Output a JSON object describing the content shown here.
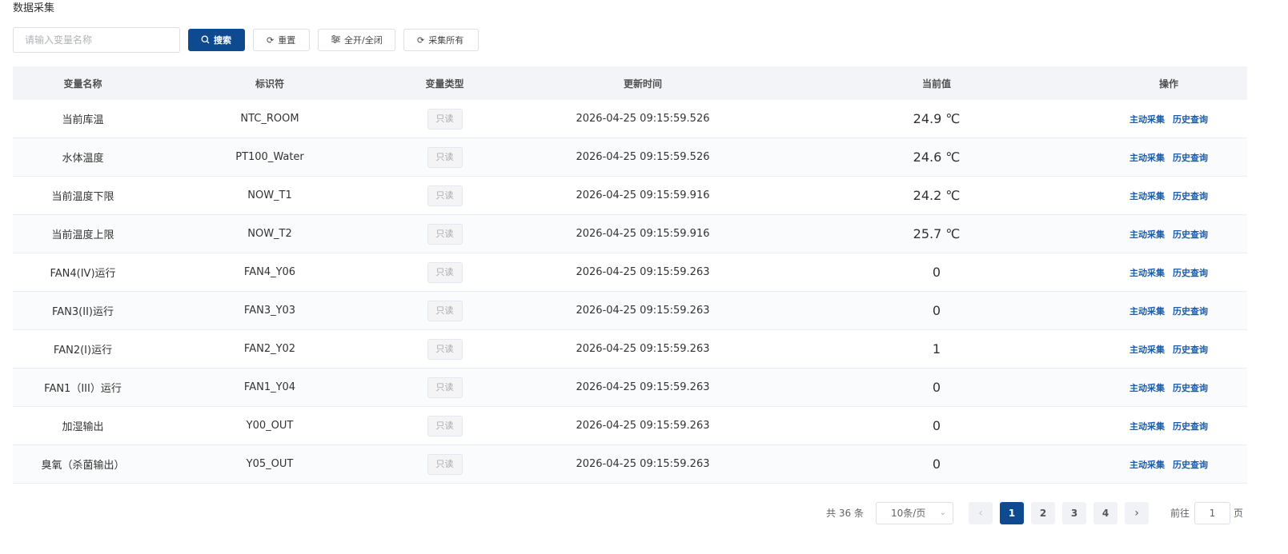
{
  "page": {
    "title": "数据采集"
  },
  "toolbar": {
    "search_placeholder": "请输入变量名称",
    "search_value": "",
    "search_label": "搜索",
    "reset_label": "重置",
    "toggle_label": "全开/全闭",
    "collect_all_label": "采集所有"
  },
  "table": {
    "headers": {
      "name": "变量名称",
      "identifier": "标识符",
      "type": "变量类型",
      "updated": "更新时间",
      "value": "当前值",
      "actions": "操作"
    },
    "rows": [
      {
        "name": "当前库温",
        "identifier": "NTC_ROOM",
        "type": "只读",
        "updated": "2026-04-25 09:15:59.526",
        "value": "24.9 ℃",
        "action1": "主动采集",
        "action2": "历史查询"
      },
      {
        "name": "水体温度",
        "identifier": "PT100_Water",
        "type": "只读",
        "updated": "2026-04-25 09:15:59.526",
        "value": "24.6 ℃",
        "action1": "主动采集",
        "action2": "历史查询"
      },
      {
        "name": "当前温度下限",
        "identifier": "NOW_T1",
        "type": "只读",
        "updated": "2026-04-25 09:15:59.916",
        "value": "24.2 ℃",
        "action1": "主动采集",
        "action2": "历史查询"
      },
      {
        "name": "当前温度上限",
        "identifier": "NOW_T2",
        "type": "只读",
        "updated": "2026-04-25 09:15:59.916",
        "value": "25.7 ℃",
        "action1": "主动采集",
        "action2": "历史查询"
      },
      {
        "name": "FAN4(IV)运行",
        "identifier": "FAN4_Y06",
        "type": "只读",
        "updated": "2026-04-25 09:15:59.263",
        "value": "0",
        "action1": "主动采集",
        "action2": "历史查询"
      },
      {
        "name": "FAN3(II)运行",
        "identifier": "FAN3_Y03",
        "type": "只读",
        "updated": "2026-04-25 09:15:59.263",
        "value": "0",
        "action1": "主动采集",
        "action2": "历史查询"
      },
      {
        "name": "FAN2(I)运行",
        "identifier": "FAN2_Y02",
        "type": "只读",
        "updated": "2026-04-25 09:15:59.263",
        "value": "1",
        "action1": "主动采集",
        "action2": "历史查询"
      },
      {
        "name": "FAN1（III）运行",
        "identifier": "FAN1_Y04",
        "type": "只读",
        "updated": "2026-04-25 09:15:59.263",
        "value": "0",
        "action1": "主动采集",
        "action2": "历史查询"
      },
      {
        "name": "加湿输出",
        "identifier": "Y00_OUT",
        "type": "只读",
        "updated": "2026-04-25 09:15:59.263",
        "value": "0",
        "action1": "主动采集",
        "action2": "历史查询"
      },
      {
        "name": "臭氧（杀菌输出）",
        "identifier": "Y05_OUT",
        "type": "只读",
        "updated": "2026-04-25 09:15:59.263",
        "value": "0",
        "action1": "主动采集",
        "action2": "历史查询"
      }
    ]
  },
  "pagination": {
    "total_text": "共 36 条",
    "page_size": "10条/页",
    "pages": [
      "1",
      "2",
      "3",
      "4"
    ],
    "current_page": "1",
    "goto_prefix": "前往",
    "goto_value": "1",
    "goto_suffix": "页"
  }
}
